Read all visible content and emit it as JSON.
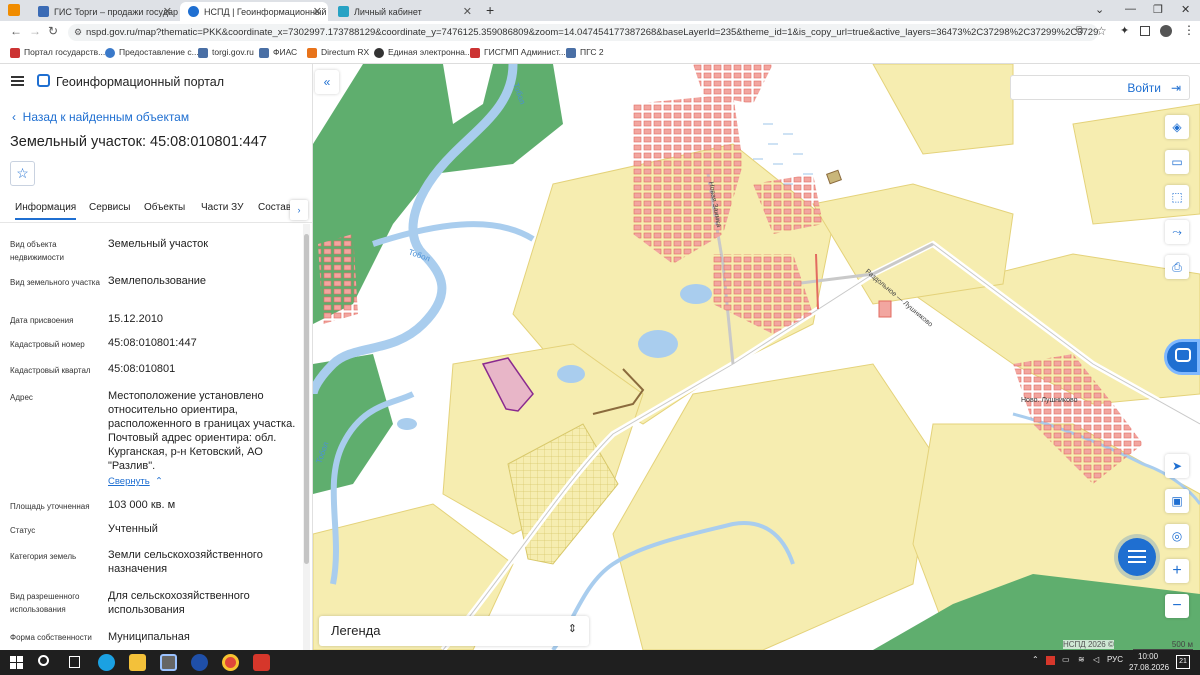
{
  "browser": {
    "tabs": [
      {
        "label": "ГИС Торги – продажи государс"
      },
      {
        "label": "НСПД | Геоинформационный п"
      },
      {
        "label": "Личный кабинет"
      }
    ],
    "url": "nspd.gov.ru/map?thematic=PKK&coordinate_x=7302997.173788129&coordinate_y=7476125.359086809&zoom=14.047454177387268&baseLayerId=235&theme_id=1&is_copy_url=true&active_layers=36473%2C37298%2C37299%2C37294%2C36048&...",
    "bookmarks": [
      "Портал государств...",
      "Предоставление с...",
      "torgi.gov.ru",
      "ФИАС",
      "Directum RX",
      "Единая электронна...",
      "ГИСГМП Админист...",
      "ПГС 2"
    ]
  },
  "portal": {
    "title": "Геоинформационный портал"
  },
  "panel": {
    "back_label": "Назад к найденным объектам",
    "object_title": "Земельный участок: 45:08:010801:447",
    "tabs": [
      "Информация",
      "Сервисы",
      "Объекты",
      "Части ЗУ",
      "Состав"
    ],
    "rows": [
      {
        "label": "Вид объекта недвижимости",
        "value": "Земельный участок"
      },
      {
        "label": "Вид земельного участка",
        "value": "Землепользование"
      },
      {
        "label": "Дата присвоения",
        "value": "15.12.2010"
      },
      {
        "label": "Кадастровый номер",
        "value": "45:08:010801:447"
      },
      {
        "label": "Кадастровый квартал",
        "value": "45:08:010801"
      },
      {
        "label": "Адрес",
        "value": "Местоположение установлено относительно ориентира, расположенного в границах участка. Почтовый адрес ориентира: обл. Курганская, р-н Кетовский, АО \"Разлив\"."
      },
      {
        "label": "Площадь уточненная",
        "value": "103 000 кв. м"
      },
      {
        "label": "Статус",
        "value": "Учтенный"
      },
      {
        "label": "Категория земель",
        "value": "Земли сельскохозяйственного назначения"
      },
      {
        "label": "Вид разрешенного использования",
        "value": "Для сельскохозяйственного использования"
      },
      {
        "label": "Форма собственности",
        "value": "Муниципальная"
      }
    ],
    "collapse_label": "Свернуть"
  },
  "map": {
    "login_label": "Войти",
    "legend_label": "Легенда",
    "credit": "НСПД 2026 ©",
    "scale": "500 м",
    "labels": [
      "Тобол",
      "Тобол",
      "Тобол",
      "Новая Заимка",
      "Раздольное — Лушниково",
      "Ново. Лушниково"
    ],
    "colors": {
      "field": "#f6edb0",
      "water": "#a9cdee",
      "forest": "#5fae6e",
      "building": "#f2a6a0",
      "parcel": "#e8b6c8",
      "parcel_border": "#8a2a8f"
    }
  },
  "taskbar": {
    "lang": "РУС",
    "time": "10:00",
    "date": "27.08.2026",
    "notif": "21"
  }
}
